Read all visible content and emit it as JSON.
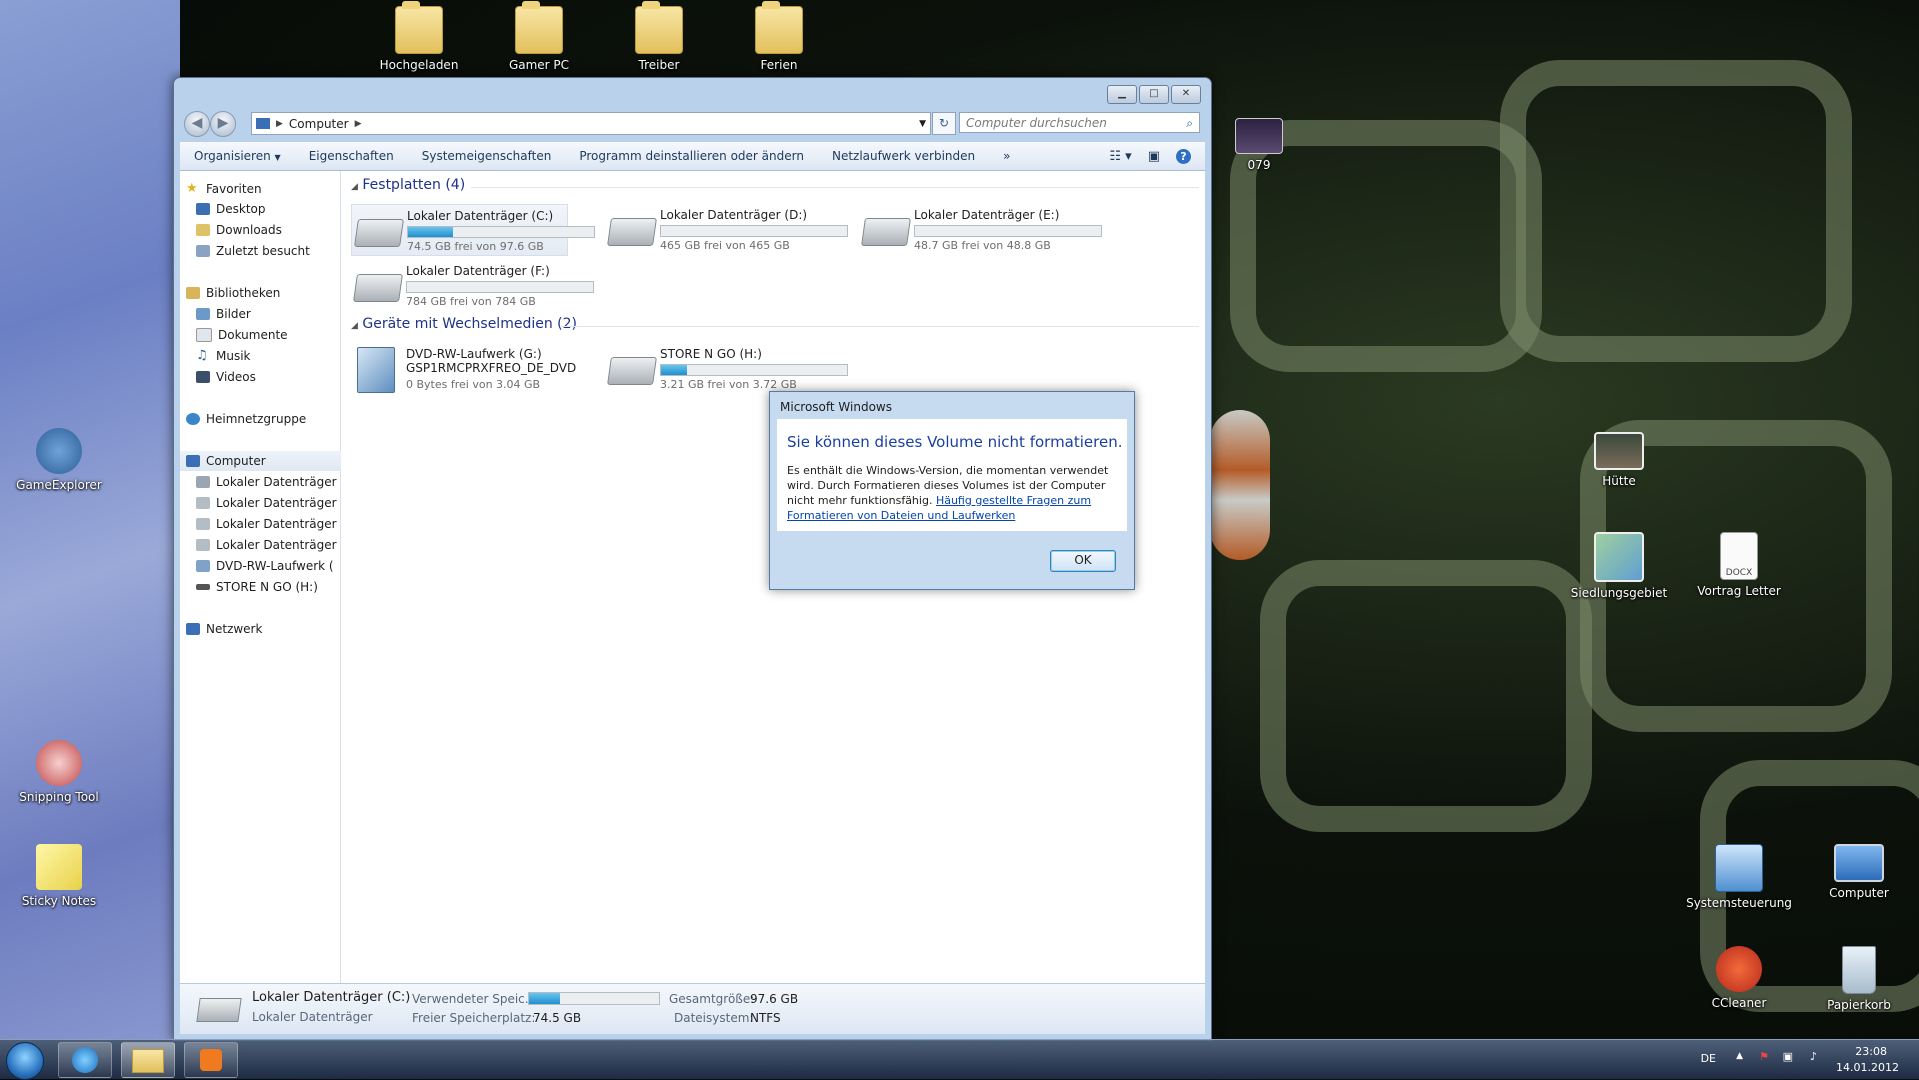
{
  "desktop": {
    "top_icons": [
      "Hochgeladen",
      "Gamer PC",
      "Treiber",
      "Ferien"
    ],
    "right_thumb_label": "079",
    "left_icons": [
      "GameExplorer",
      "Snipping Tool",
      "Sticky Notes"
    ],
    "right_icons": [
      "Hütte",
      "Siedlungsgebiet",
      "Vortrag Letter",
      "Systemsteuerung",
      "Computer",
      "CCleaner",
      "Papierkorb"
    ]
  },
  "window": {
    "address": {
      "root_icon": "computer-icon",
      "crumb": "Computer"
    },
    "search_placeholder": "Computer durchsuchen",
    "toolbar": {
      "organize": "Organisieren",
      "properties": "Eigenschaften",
      "system_properties": "Systemeigenschaften",
      "uninstall": "Programm deinstallieren oder ändern",
      "map_drive": "Netzlaufwerk verbinden",
      "more": "»"
    },
    "nav": {
      "favorites": "Favoriten",
      "fav_items": [
        "Desktop",
        "Downloads",
        "Zuletzt besucht"
      ],
      "libraries": "Bibliotheken",
      "lib_items": [
        "Bilder",
        "Dokumente",
        "Musik",
        "Videos"
      ],
      "homegroup": "Heimnetzgruppe",
      "computer": "Computer",
      "computer_items": [
        "Lokaler Datenträger",
        "Lokaler Datenträger",
        "Lokaler Datenträger",
        "Lokaler Datenträger",
        "DVD-RW-Laufwerk (",
        "STORE N GO (H:)"
      ],
      "network": "Netzwerk"
    },
    "groups": {
      "hdd_header": "Festplatten (4)",
      "removable_header": "Geräte mit Wechselmedien (2)"
    },
    "drives": [
      {
        "name": "Lokaler Datenträger (C:)",
        "free": "74.5 GB frei von 97.6 GB",
        "used_fraction": 0.24
      },
      {
        "name": "Lokaler Datenträger (D:)",
        "free": "465 GB frei von 465 GB",
        "used_fraction": 0.0
      },
      {
        "name": "Lokaler Datenträger (E:)",
        "free": "48.7 GB frei von 48.8 GB",
        "used_fraction": 0.0
      },
      {
        "name": "Lokaler Datenträger (F:)",
        "free": "784 GB frei von 784 GB",
        "used_fraction": 0.0
      }
    ],
    "removable": [
      {
        "name": "DVD-RW-Laufwerk (G:)",
        "label": "GSP1RMCPRXFREO_DE_DVD",
        "free": "0 Bytes frei von 3.04 GB"
      },
      {
        "name": "STORE N GO (H:)",
        "free": "3.21 GB frei von 3.72 GB",
        "used_fraction": 0.14
      }
    ],
    "details": {
      "name": "Lokaler Datenträger (C:)",
      "type": "Lokaler Datenträger",
      "used_label": "Verwendeter Speic...",
      "used_fraction": 0.24,
      "free_label": "Freier Speicherplatz:",
      "free_value": "74.5 GB",
      "total_label": "Gesamtgröße:",
      "total_value": "97.6 GB",
      "fs_label": "Dateisystem:",
      "fs_value": "NTFS"
    }
  },
  "dialog": {
    "title": "Microsoft Windows",
    "heading": "Sie können dieses Volume nicht formatieren.",
    "text": "Es enthält die Windows-Version, die momentan verwendet wird. Durch Formatieren dieses Volumes ist der Computer nicht mehr funktionsfähig.",
    "link": "Häufig gestellte Fragen zum Formatieren von Dateien und Laufwerken",
    "ok": "OK"
  },
  "taskbar": {
    "language": "DE",
    "time": "23:08",
    "date": "14.01.2012"
  },
  "colors": {
    "accent": "#1e3287",
    "link": "#0645ad",
    "progress": "#1f8fd0"
  }
}
